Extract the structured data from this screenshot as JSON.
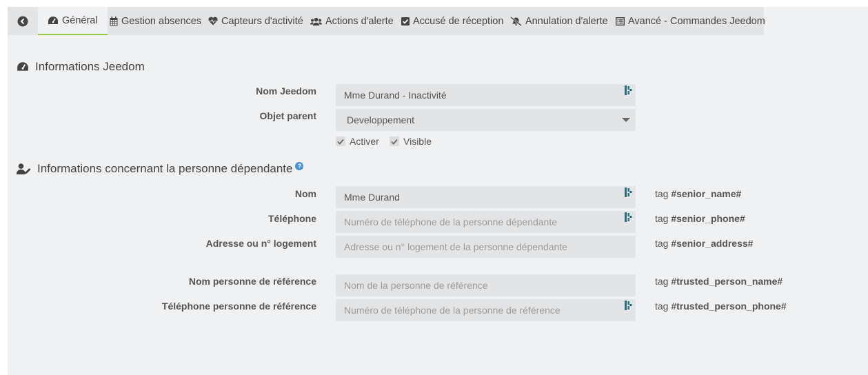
{
  "tabs": [
    {
      "label": "Général",
      "icon": "dashboard-icon",
      "active": true
    },
    {
      "label": "Gestion absences",
      "icon": "calendar-icon"
    },
    {
      "label": "Capteurs d'activité",
      "icon": "heartbeat-icon"
    },
    {
      "label": "Actions d'alerte",
      "icon": "users-icon"
    },
    {
      "label": "Accusé de réception",
      "icon": "check-square-icon"
    },
    {
      "label": "Annulation d'alerte",
      "icon": "bell-slash-icon"
    },
    {
      "label": "Avancé - Commandes Jeedom",
      "icon": "list-alt-icon"
    }
  ],
  "jeedom": {
    "title": "Informations Jeedom",
    "name_label": "Nom Jeedom",
    "name_value": "Mme Durand - Inactivité",
    "parent_label": "Objet parent",
    "parent_value": "Developpement",
    "activate_label": "Activer",
    "visible_label": "Visible"
  },
  "person": {
    "title": "Informations concernant la personne dépendante",
    "help": "?",
    "fields": [
      {
        "label": "Nom",
        "value": "Mme Durand",
        "placeholder": "",
        "tag_prefix": "tag",
        "tag": "#senior_name#"
      },
      {
        "label": "Téléphone",
        "value": "",
        "placeholder": "Numéro de téléphone de la personne dépendante",
        "tag_prefix": "tag",
        "tag": "#senior_phone#"
      },
      {
        "label": "Adresse ou n° logement",
        "value": "",
        "placeholder": "Adresse ou n° logement de la personne dépendante",
        "tag_prefix": "tag",
        "tag": "#senior_address#"
      },
      {
        "label": "Nom personne de référence",
        "value": "",
        "placeholder": "Nom de la personne de référence",
        "tag_prefix": "tag",
        "tag": "#trusted_person_name#"
      },
      {
        "label": "Téléphone personne de référence",
        "value": "",
        "placeholder": "Numéro de téléphone de la personne de référence",
        "tag_prefix": "tag",
        "tag": "#trusted_person_phone#"
      }
    ]
  },
  "colors": {
    "accent": "#94c93d",
    "cmd_icon": "#2a6e80",
    "help": "#4a90d9"
  }
}
